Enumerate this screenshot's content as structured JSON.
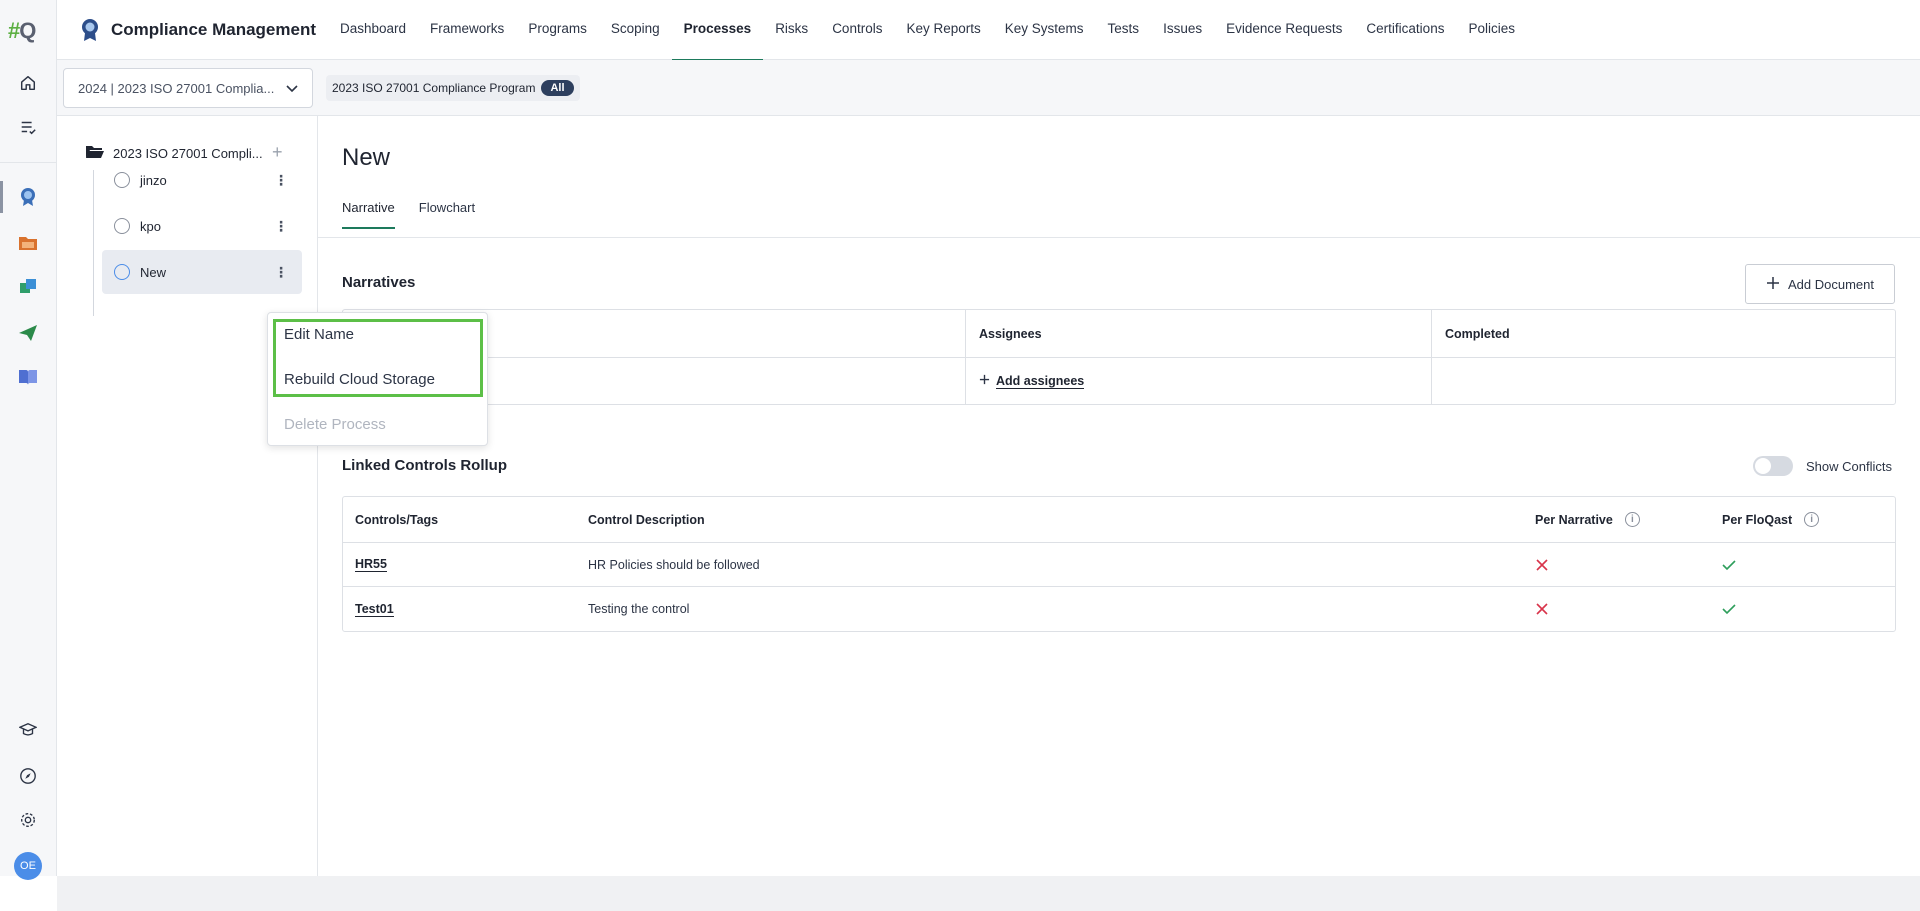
{
  "app": {
    "logo_hash": "#",
    "logo_q": "Q",
    "title": "Compliance Management"
  },
  "nav": {
    "items": [
      {
        "label": "Dashboard"
      },
      {
        "label": "Frameworks"
      },
      {
        "label": "Programs"
      },
      {
        "label": "Scoping"
      },
      {
        "label": "Processes",
        "active": true
      },
      {
        "label": "Risks"
      },
      {
        "label": "Controls"
      },
      {
        "label": "Key Reports"
      },
      {
        "label": "Key Systems"
      },
      {
        "label": "Tests"
      },
      {
        "label": "Issues"
      },
      {
        "label": "Evidence Requests"
      },
      {
        "label": "Certifications"
      },
      {
        "label": "Policies"
      }
    ]
  },
  "subheader": {
    "program_select_value": "2024 | 2023 ISO 27001 Complia...",
    "program_chip_label": "2023 ISO 27001 Compliance Program",
    "program_chip_badge": "All"
  },
  "tree": {
    "root_label": "2023 ISO 27001 Compli...",
    "items": [
      {
        "label": "jinzo"
      },
      {
        "label": "kpo"
      },
      {
        "label": "New",
        "selected": true
      }
    ]
  },
  "context_menu": {
    "edit_name": "Edit Name",
    "rebuild_cloud_storage": "Rebuild Cloud Storage",
    "delete_process": "Delete Process"
  },
  "main": {
    "page_title": "New",
    "tabs": [
      {
        "label": "Narrative",
        "active": true
      },
      {
        "label": "Flowchart"
      }
    ],
    "narratives": {
      "title": "Narratives",
      "add_document_label": "Add Document",
      "headers": {
        "assignees": "Assignees",
        "completed": "Completed"
      },
      "add_assignees_label": "Add assignees"
    },
    "rollup": {
      "title": "Linked Controls Rollup",
      "show_conflicts_label": "Show Conflicts",
      "headers": {
        "controls": "Controls/Tags",
        "description": "Control Description",
        "per_narrative": "Per Narrative",
        "per_floqast": "Per FloQast"
      },
      "rows": [
        {
          "control": "HR55",
          "description": "HR Policies should be followed"
        },
        {
          "control": "Test01",
          "description": "Testing the control"
        }
      ]
    }
  },
  "user": {
    "initials": "OE"
  },
  "colors": {
    "accent_green": "#1d7a5c",
    "highlight_green": "#5cbf47",
    "x_red": "#d8344a",
    "check_green": "#2e9e5b",
    "avatar_blue": "#4b8de8"
  }
}
